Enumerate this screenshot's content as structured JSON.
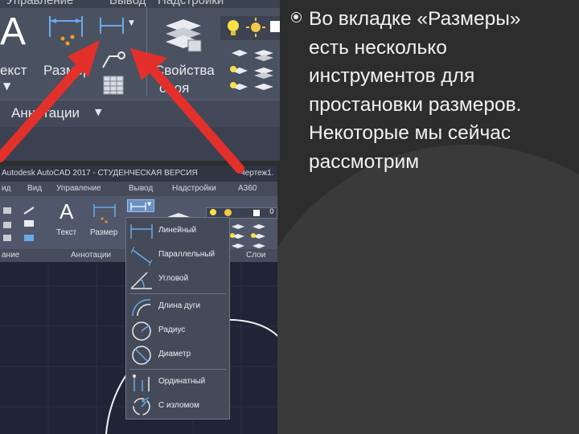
{
  "slide": {
    "lines": [
      "Во вкладке «Размеры»",
      "есть несколько",
      "инструментов для",
      "простановки размеров.",
      "Некоторые мы сейчас",
      "рассмотрим"
    ]
  },
  "top_ribbon": {
    "tabs": [
      "Управление",
      "Вывод",
      "Надстройки"
    ],
    "text_label": "екст",
    "dimension_label": "Размер",
    "properties_label_1": "Свойства",
    "properties_label_2": "слоя",
    "panel_title": "Аннотации"
  },
  "screenshot": {
    "title": "Autodesk AutoCAD 2017 - СТУДЕНЧЕСКАЯ ВЕРСИЯ",
    "file": "Чертеж1.",
    "tabs": [
      "ид",
      "Вид",
      "Управление",
      "Вывод",
      "Надстройки",
      "A360"
    ],
    "ribbon_text_label": "Текст",
    "ribbon_dim_label": "Размер",
    "panels": [
      "ание",
      "Аннотации",
      "Слои"
    ],
    "layer_value": "0"
  },
  "dimension_menu": {
    "items": [
      {
        "label": "Линейный",
        "icon": "linear-dim-icon"
      },
      {
        "label": "Параллельный",
        "icon": "aligned-dim-icon"
      },
      {
        "label": "Угловой",
        "icon": "angular-dim-icon"
      },
      {
        "label": "Длина дуги",
        "icon": "arc-length-dim-icon"
      },
      {
        "label": "Радиус",
        "icon": "radius-dim-icon"
      },
      {
        "label": "Диаметр",
        "icon": "diameter-dim-icon"
      },
      {
        "label": "Ординатный",
        "icon": "ordinate-dim-icon"
      },
      {
        "label": "С изломом",
        "icon": "jogged-dim-icon"
      }
    ]
  },
  "colors": {
    "ribbon": "#4a5161",
    "canvas": "#1f2536",
    "arrow": "#e3302b",
    "dim_blue": "#6aa9e8"
  }
}
